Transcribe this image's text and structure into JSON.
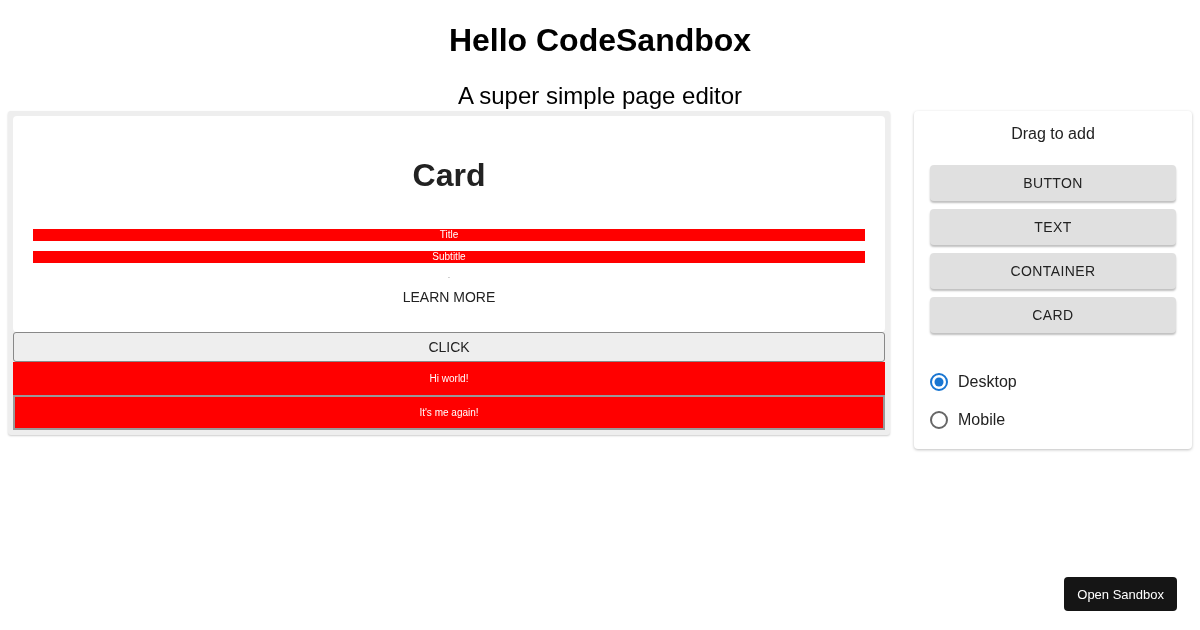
{
  "header": {
    "title": "Hello CodeSandbox",
    "subtitle": "A super simple page editor"
  },
  "canvas": {
    "items": [
      {
        "kind": "card",
        "heading": "Card",
        "title": "Title",
        "subtitle": "Subtitle",
        "caption": ".",
        "action": "LEARN MORE"
      },
      {
        "kind": "button",
        "label": "CLICK"
      },
      {
        "kind": "text",
        "text": "Hi world!",
        "bordered": false
      },
      {
        "kind": "text",
        "text": "It's me again!",
        "bordered": true
      }
    ]
  },
  "toolbox": {
    "heading": "Drag to add",
    "tools": [
      "BUTTON",
      "TEXT",
      "CONTAINER",
      "CARD"
    ],
    "modes": [
      {
        "label": "Desktop",
        "selected": true
      },
      {
        "label": "Mobile",
        "selected": false
      }
    ]
  },
  "footer": {
    "button": "Open Sandbox"
  }
}
